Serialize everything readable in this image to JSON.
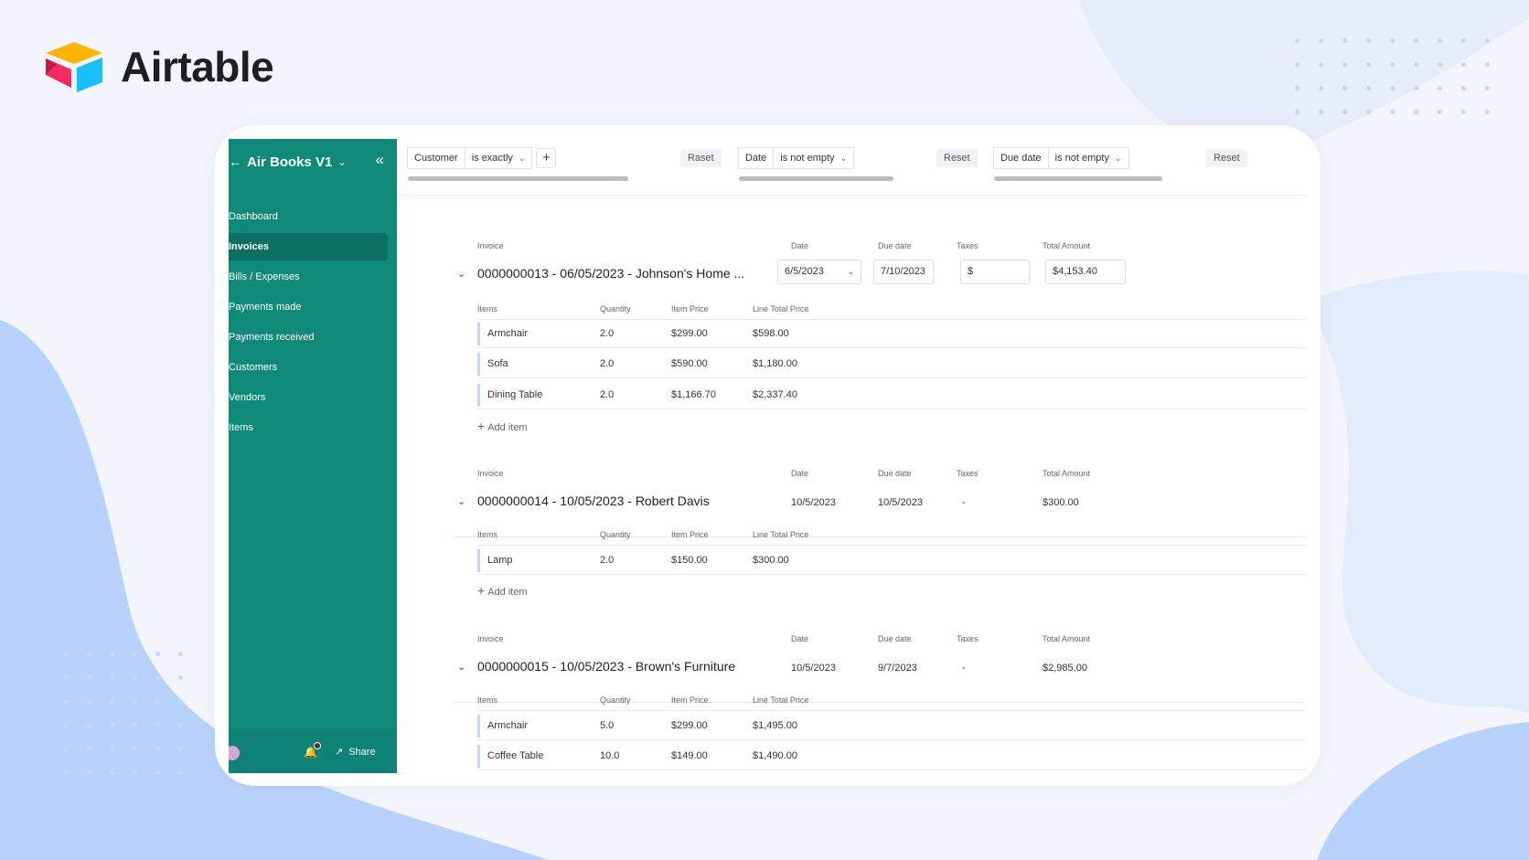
{
  "brand": {
    "name": "Airtable"
  },
  "colors": {
    "sidebar": "#0f8a79",
    "accent": "#2d7be6",
    "background": "#f2f5fb"
  },
  "sidebar": {
    "title": "Air Books V1",
    "items": [
      {
        "label": "Dashboard"
      },
      {
        "label": "Invoices",
        "active": true
      },
      {
        "label": "Bills / Expenses"
      },
      {
        "label": "Payments made"
      },
      {
        "label": "Payments received"
      },
      {
        "label": "Customers"
      },
      {
        "label": "Vendors"
      },
      {
        "label": "Items"
      }
    ],
    "share_label": "Share"
  },
  "filters": [
    {
      "field": "Customer",
      "operator": "is exactly",
      "reset_label": "Raset"
    },
    {
      "field": "Date",
      "operator": "is not empty",
      "reset_label": "Reset"
    },
    {
      "field": "Due date",
      "operator": "is not empty",
      "reset_label": "Reset"
    }
  ],
  "labels": {
    "invoice": "Invoice",
    "date": "Date",
    "due_date": "Due date",
    "taxes": "Taxes",
    "total_amount": "Total Amount",
    "items": "Items",
    "quantity": "Quantity",
    "item_price": "Item Price",
    "line_total": "Line Total Price",
    "add_item": "Add item"
  },
  "invoices": [
    {
      "title": "0000000013 - 06/05/2023 - Johnson's Home ...",
      "date": "6/5/2023",
      "due_date": "7/10/2023",
      "taxes": "$",
      "total": "$4,153.40",
      "items": [
        {
          "name": "Armchair",
          "qty": "2.0",
          "price": "$299.00",
          "total": "$598.00"
        },
        {
          "name": "Sofa",
          "qty": "2.0",
          "price": "$590.00",
          "total": "$1,180.00"
        },
        {
          "name": "Dining Table",
          "qty": "2.0",
          "price": "$1,166.70",
          "total": "$2,337.40"
        }
      ]
    },
    {
      "title": "0000000014 - 10/05/2023 - Robert Davis",
      "date": "10/5/2023",
      "due_date": "10/5/2023",
      "taxes": "-",
      "total": "$300.00",
      "items": [
        {
          "name": "Lamp",
          "qty": "2.0",
          "price": "$150.00",
          "total": "$300.00"
        }
      ]
    },
    {
      "title": "0000000015 - 10/05/2023 - Brown's Furniture",
      "date": "10/5/2023",
      "due_date": "9/7/2023",
      "taxes": "-",
      "total": "$2,985.00",
      "items": [
        {
          "name": "Armchair",
          "qty": "5.0",
          "price": "$299.00",
          "total": "$1,495.00"
        },
        {
          "name": "Coffee Table",
          "qty": "10.0",
          "price": "$149.00",
          "total": "$1,490.00"
        }
      ]
    }
  ]
}
